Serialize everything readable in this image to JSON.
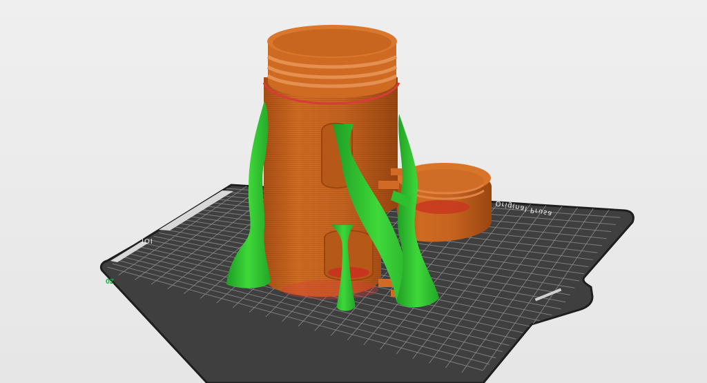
{
  "viewport": {
    "bed": {
      "label": "Original Prusa",
      "label_left": "IOI",
      "axis_label": "ZO",
      "colors": {
        "surface": "#3f3f3f",
        "grid_line": "#8a8a8a",
        "edge": "#1e1e1e"
      }
    },
    "model_color": "#c8651f",
    "support_color": "#33cc33",
    "highlight_color": "#d93a3a"
  }
}
